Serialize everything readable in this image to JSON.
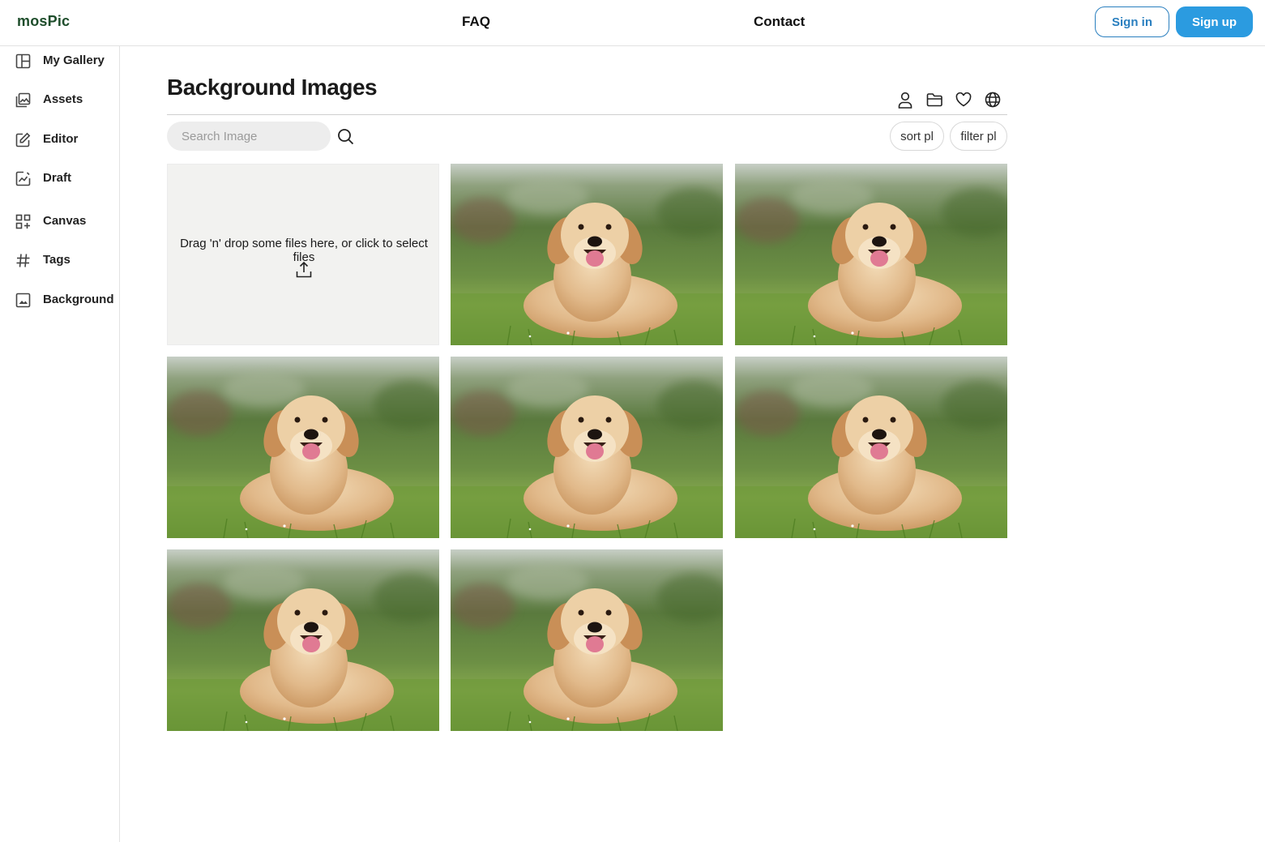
{
  "header": {
    "brand": "mosPic",
    "nav": {
      "faq": "FAQ",
      "contact": "Contact"
    },
    "sign_in": "Sign in",
    "sign_up": "Sign up"
  },
  "sidebar": {
    "items": [
      {
        "label": "My Gallery",
        "icon": "layout-icon"
      },
      {
        "label": "Assets",
        "icon": "images-icon"
      },
      {
        "label": "Editor",
        "icon": "edit-icon"
      },
      {
        "label": "Draft",
        "icon": "chart-draft-icon"
      },
      {
        "label": "Canvas",
        "icon": "grid-add-icon"
      },
      {
        "label": "Tags",
        "icon": "hash-icon"
      },
      {
        "label": "Background",
        "icon": "image-icon"
      }
    ]
  },
  "main": {
    "title": "Background Images",
    "toolbar_icons": [
      "user-icon",
      "folder-icon",
      "heart-icon",
      "globe-icon"
    ],
    "search": {
      "placeholder": "Search Image",
      "value": ""
    },
    "sort_label": "sort pl",
    "filter_label": "filter pl",
    "dropzone_text": "Drag 'n' drop some files here, or click to select files",
    "image_count": 8
  },
  "colors": {
    "brand": "#1e4d2b",
    "accent": "#2b9be0",
    "accent_outline": "#2a7fbf"
  }
}
